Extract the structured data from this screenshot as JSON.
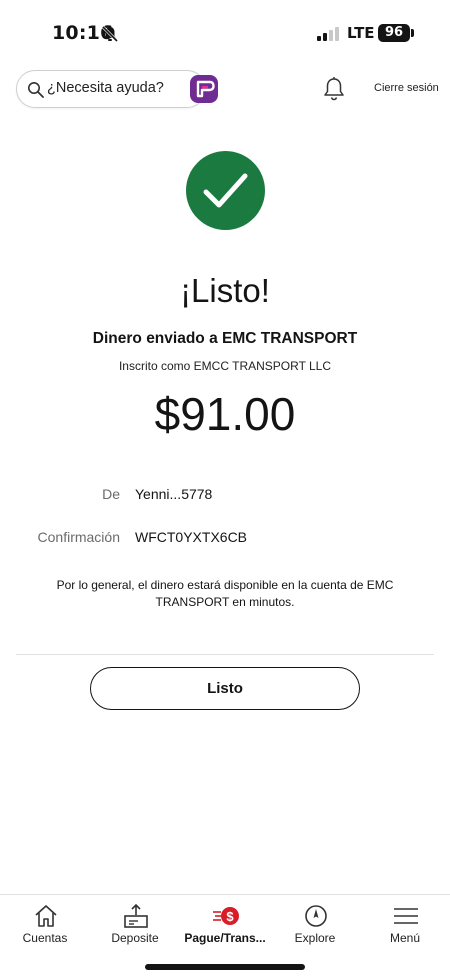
{
  "status_bar": {
    "time": "10:16",
    "network": "LTE",
    "battery": "96"
  },
  "header": {
    "search_placeholder": "¿Necesita ayuda?",
    "signout_label": "Cierre sesión"
  },
  "confirmation": {
    "title": "¡Listo!",
    "sent_to": "Dinero enviado a EMC  TRANSPORT",
    "registered_as": "Inscrito como EMCC TRANSPORT LLC",
    "amount": "$91.00",
    "from_label": "De",
    "from_value": "Yenni...5778",
    "confirmation_label": "Confirmación",
    "confirmation_value": "WFCT0YXTX6CB",
    "note": "Por lo general, el dinero estará disponible en la cuenta de EMC  TRANSPORT en minutos.",
    "done_label": "Listo"
  },
  "nav": {
    "items": [
      {
        "label": "Cuentas",
        "icon": "home-icon"
      },
      {
        "label": "Deposite",
        "icon": "deposit-icon"
      },
      {
        "label": "Pague/Trans...",
        "icon": "pay-transfer-icon",
        "active": true
      },
      {
        "label": "Explore",
        "icon": "compass-icon"
      },
      {
        "label": "Menú",
        "icon": "menu-icon"
      }
    ]
  },
  "colors": {
    "success_green": "#1b7a40",
    "brand_purple": "#6f2c91",
    "accent_red": "#d71e28"
  }
}
